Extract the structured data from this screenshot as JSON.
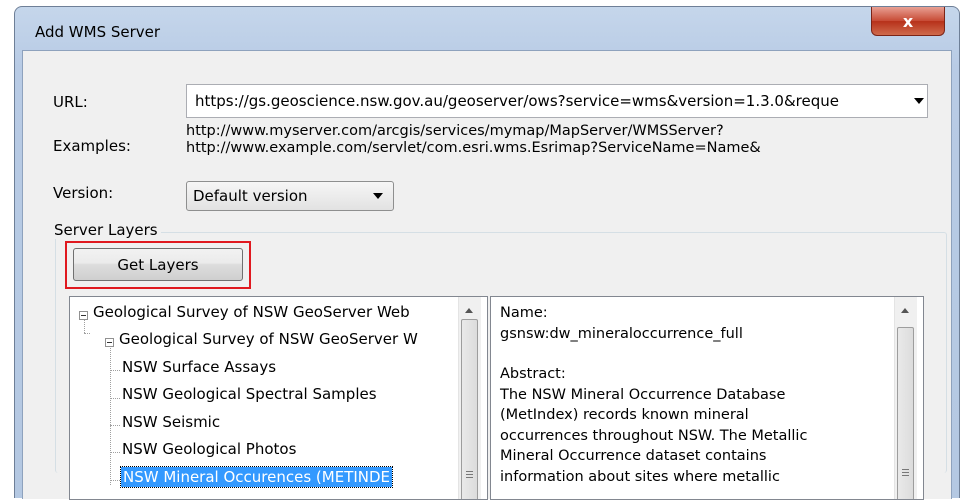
{
  "window": {
    "title": "Add WMS Server",
    "close_label": "x"
  },
  "form": {
    "url_label": "URL:",
    "url_value": "https://gs.geoscience.nsw.gov.au/geoserver/ows?service=wms&version=1.3.0&reque",
    "examples_label": "Examples:",
    "examples": [
      "http://www.myserver.com/arcgis/services/mymap/MapServer/WMSServer?",
      "http://www.example.com/servlet/com.esri.wms.Esrimap?ServiceName=Name&"
    ],
    "version_label": "Version:",
    "version_value": "Default version"
  },
  "server_layers": {
    "group_label": "Server Layers",
    "get_layers_label": "Get Layers",
    "tree": [
      "Geological Survey of NSW GeoServer Web",
      "Geological Survey of NSW GeoServer W",
      "NSW Surface Assays",
      "NSW Geological Spectral Samples",
      "NSW Seismic",
      "NSW Geological Photos",
      "NSW Mineral Occurences (METINDE"
    ],
    "selected_index": 6
  },
  "details": {
    "name_label": "Name:",
    "name_value": "gsnsw:dw_mineraloccurrence_full",
    "abstract_label": "Abstract:",
    "abstract_lines": [
      "The NSW Mineral Occurrence Database",
      "(MetIndex) records known mineral",
      "occurrences throughout NSW. The Metallic",
      "Mineral Occurrence dataset contains",
      "information about sites where metallic"
    ]
  },
  "colors": {
    "selection": "#3399ff",
    "highlight_box": "#e0191f",
    "close_button": "#c74a34"
  }
}
